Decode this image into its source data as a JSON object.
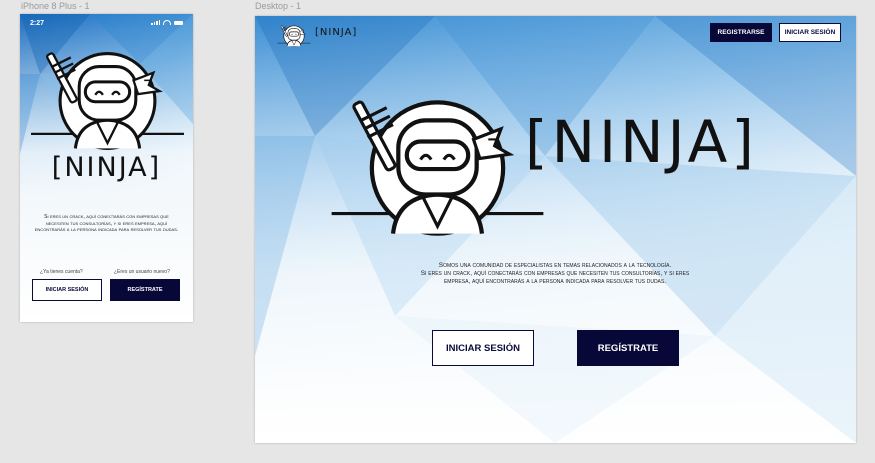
{
  "frames": {
    "mobile_label": "iPhone 8 Plus - 1",
    "desktop_label": "Desktop - 1"
  },
  "mobile": {
    "status_time": "2:27",
    "brand": "[NINJA]",
    "description": "Si eres un crack, aquí conectarás con empresas que necesiten tus consultorías, y si eres empresa, aquí encontrarás a la persona indicada para resolver tus dudas.",
    "login_prompt": "¿Ya tienes cuenta?",
    "signup_prompt": "¿Eres un usuario nuevo?",
    "login_button": "INICIAR SESIÓN",
    "signup_button": "REGÍSTRATE"
  },
  "desktop": {
    "header": {
      "logo_text": "[NINJA]",
      "register_button": "REGISTRARSE",
      "login_button": "INICIAR SESIÓN"
    },
    "hero_brand": "[NINJA]",
    "description_line1": "Somos una comunidad de especialistas en temas relacionados a la tecnología.",
    "description_line2": "Si eres un crack, aquí conectarás con empresas que necesiten tus consultorías, y si eres",
    "description_line3": "empresa, aquí encontrarás a la persona indicada para resolver tus dudas.",
    "login_button": "INICIAR SESIÓN",
    "signup_button": "REGÍSTRATE"
  },
  "colors": {
    "navy": "#070738",
    "sky_dark": "#1d73c4",
    "sky_light": "#eaf4fb"
  },
  "icons": [
    "ninja-logo-icon",
    "signal-icon",
    "wifi-icon",
    "battery-icon"
  ]
}
